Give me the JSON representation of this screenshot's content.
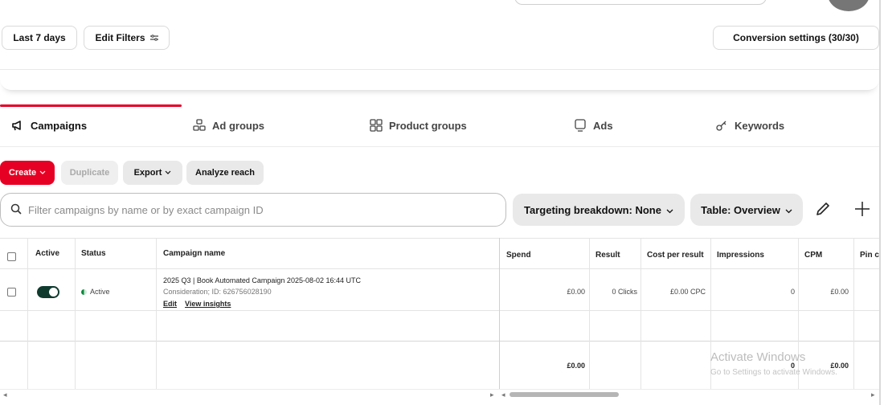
{
  "filters_bar": {
    "date_range_label": "Last 7 days",
    "edit_filters_label": "Edit Filters",
    "conversion_settings_label": "Conversion settings (30/30)"
  },
  "tabs": [
    {
      "label": "Campaigns",
      "icon": "megaphone-icon",
      "active": true
    },
    {
      "label": "Ad groups",
      "icon": "ad-groups-icon",
      "active": false
    },
    {
      "label": "Product groups",
      "icon": "grid-icon",
      "active": false
    },
    {
      "label": "Ads",
      "icon": "ad-icon",
      "active": false
    },
    {
      "label": "Keywords",
      "icon": "key-icon",
      "active": false
    }
  ],
  "actions": {
    "create_label": "Create",
    "duplicate_label": "Duplicate",
    "export_label": "Export",
    "analyze_reach_label": "Analyze reach"
  },
  "search": {
    "placeholder": "Filter campaigns by name or by exact campaign ID",
    "value": ""
  },
  "dropdowns": {
    "targeting_breakdown": "Targeting breakdown: None",
    "table_view": "Table: Overview"
  },
  "table": {
    "headers": {
      "active": "Active",
      "status": "Status",
      "campaign_name": "Campaign name",
      "spend": "Spend",
      "result": "Result",
      "cost_per_result": "Cost per result",
      "impressions": "Impressions",
      "cpm": "CPM",
      "pin_clicks": "Pin c"
    },
    "rows": [
      {
        "active": true,
        "status": "Active",
        "name": "2025 Q3 | Book Automated Campaign 2025-08-02 16:44 UTC",
        "subtitle": "Consideration; ID: 626756028190",
        "edit_label": "Edit",
        "view_insights_label": "View insights",
        "spend": "£0.00",
        "result": "0 Clicks",
        "cost_per_result": "£0.00 CPC",
        "impressions": "0",
        "cpm": "£0.00"
      }
    ],
    "totals": {
      "spend": "£0.00",
      "impressions": "0",
      "cpm": "£0.00"
    }
  },
  "watermark": {
    "title": "Activate Windows",
    "subtitle": "Go to Settings to activate Windows."
  },
  "colors": {
    "accent": "#e60023",
    "toggle_on": "#0f3b2e",
    "status_active": "#0b8a3c"
  }
}
